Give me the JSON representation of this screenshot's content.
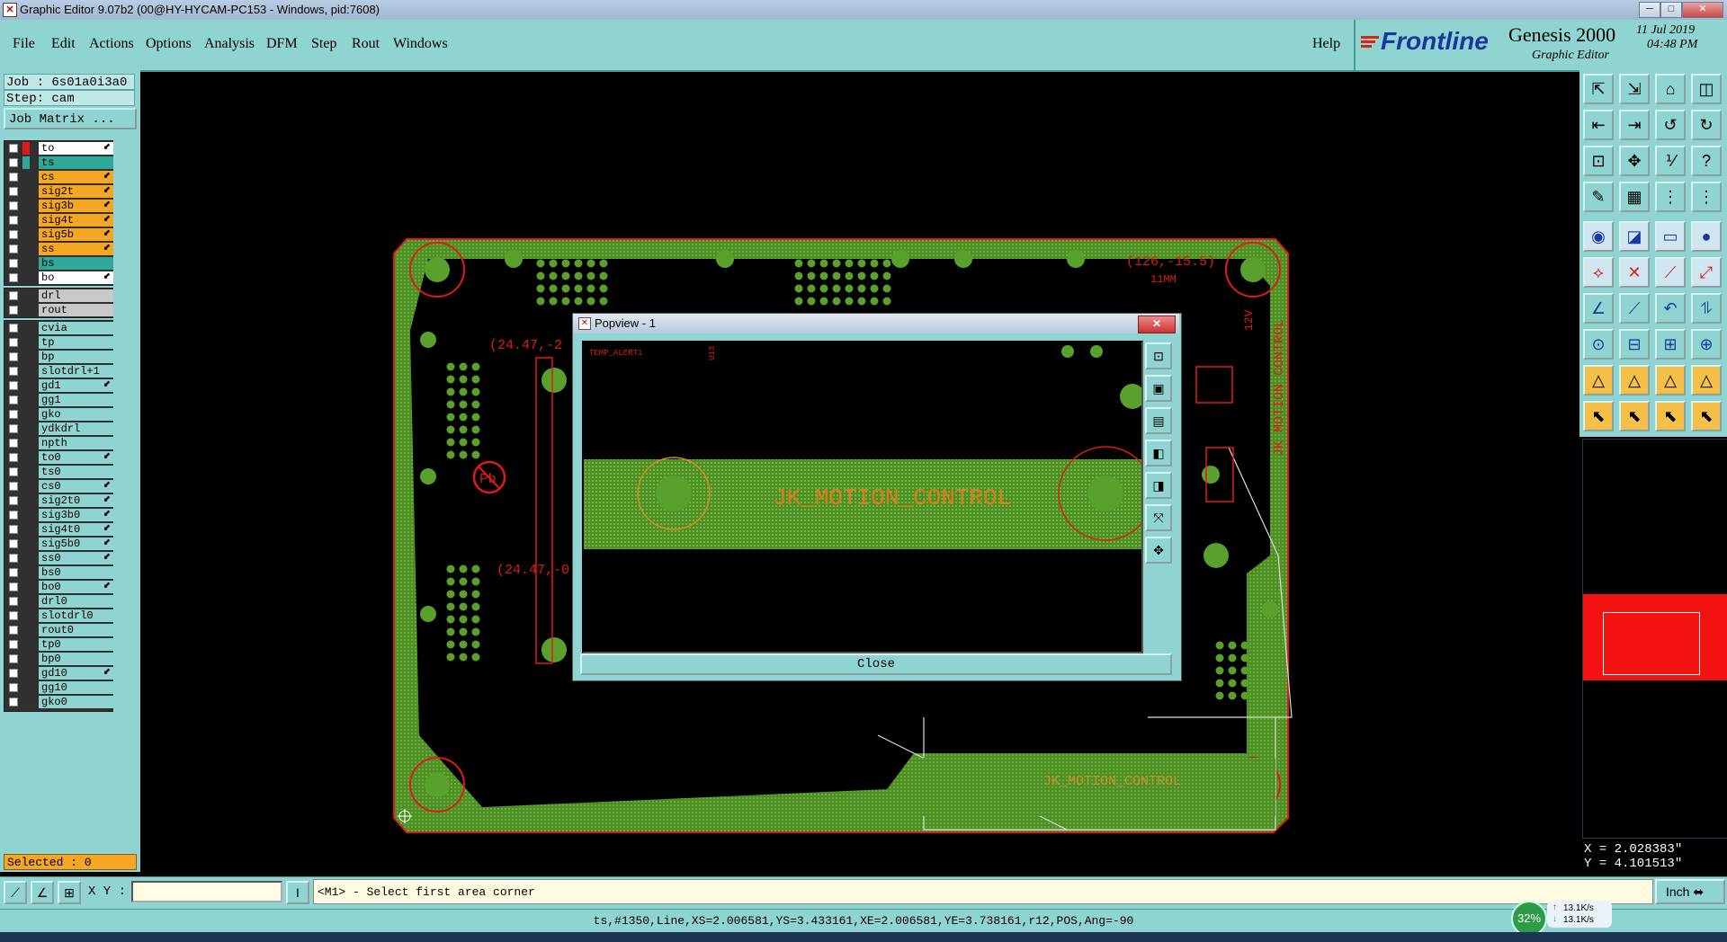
{
  "window": {
    "title": "Graphic Editor 9.07b2 (00@HY-HYCAM-PC153 - Windows, pid:7608)",
    "controls": [
      "─",
      "□",
      "✕"
    ]
  },
  "menu": {
    "items": [
      "File",
      "Edit",
      "Actions",
      "Options",
      "Analysis",
      "DFM",
      "Step",
      "Rout",
      "Windows"
    ],
    "help": "Help"
  },
  "logo": {
    "brand": "Frontline",
    "product": "Genesis 2000",
    "subtitle": "Graphic Editor",
    "date": "11 Jul 2019",
    "time": "04:48 PM"
  },
  "job": {
    "job_label": "Job : 6s01a0i3a0",
    "step_label": "Step: cam",
    "matrix_button": "Job Matrix ..."
  },
  "layers_group1": [
    {
      "name": "to",
      "color": "#ffffff",
      "mark": "⬋"
    },
    {
      "name": "ts",
      "color": "#2fa89a",
      "mark": ""
    },
    {
      "name": "cs",
      "color": "#f5a623",
      "mark": "⬋"
    },
    {
      "name": "sig2t",
      "color": "#f5a623",
      "mark": "⬋"
    },
    {
      "name": "sig3b",
      "color": "#f5a623",
      "mark": "⬋"
    },
    {
      "name": "sig4t",
      "color": "#f5a623",
      "mark": "⬋"
    },
    {
      "name": "sig5b",
      "color": "#f5a623",
      "mark": "⬋"
    },
    {
      "name": "ss",
      "color": "#f5a623",
      "mark": "⬋"
    },
    {
      "name": "bs",
      "color": "#2fa89a",
      "mark": ""
    },
    {
      "name": "bo",
      "color": "#ffffff",
      "mark": "⬋"
    }
  ],
  "layers_group2": [
    {
      "name": "drl",
      "color": "#c8c8c8",
      "mark": ""
    },
    {
      "name": "rout",
      "color": "#c8c8c8",
      "mark": ""
    }
  ],
  "layers_group3": [
    {
      "name": "cvia",
      "color": "#8fd4d0",
      "mark": ""
    },
    {
      "name": "tp",
      "color": "#8fd4d0",
      "mark": ""
    },
    {
      "name": "bp",
      "color": "#8fd4d0",
      "mark": ""
    },
    {
      "name": "slotdrl+1",
      "color": "#8fd4d0",
      "mark": ""
    },
    {
      "name": "gd1",
      "color": "#8fd4d0",
      "mark": "⬋"
    },
    {
      "name": "gg1",
      "color": "#8fd4d0",
      "mark": ""
    },
    {
      "name": "gko",
      "color": "#8fd4d0",
      "mark": ""
    },
    {
      "name": "ydkdrl",
      "color": "#8fd4d0",
      "mark": ""
    },
    {
      "name": "npth",
      "color": "#8fd4d0",
      "mark": ""
    },
    {
      "name": "to0",
      "color": "#8fd4d0",
      "mark": "⬋"
    },
    {
      "name": "ts0",
      "color": "#8fd4d0",
      "mark": ""
    },
    {
      "name": "cs0",
      "color": "#8fd4d0",
      "mark": "⬋"
    },
    {
      "name": "sig2t0",
      "color": "#8fd4d0",
      "mark": "⬋"
    },
    {
      "name": "sig3b0",
      "color": "#8fd4d0",
      "mark": "⬋"
    },
    {
      "name": "sig4t0",
      "color": "#8fd4d0",
      "mark": "⬋"
    },
    {
      "name": "sig5b0",
      "color": "#8fd4d0",
      "mark": "⬋"
    },
    {
      "name": "ss0",
      "color": "#8fd4d0",
      "mark": "⬋"
    },
    {
      "name": "bs0",
      "color": "#8fd4d0",
      "mark": ""
    },
    {
      "name": "bo0",
      "color": "#8fd4d0",
      "mark": "⬋"
    },
    {
      "name": "drl0",
      "color": "#8fd4d0",
      "mark": ""
    },
    {
      "name": "slotdrl0",
      "color": "#8fd4d0",
      "mark": ""
    },
    {
      "name": "rout0",
      "color": "#8fd4d0",
      "mark": ""
    },
    {
      "name": "tp0",
      "color": "#8fd4d0",
      "mark": ""
    },
    {
      "name": "bp0",
      "color": "#8fd4d0",
      "mark": ""
    },
    {
      "name": "gd10",
      "color": "#8fd4d0",
      "mark": "⬋"
    },
    {
      "name": "gg10",
      "color": "#8fd4d0",
      "mark": ""
    },
    {
      "name": "gko0",
      "color": "#8fd4d0",
      "mark": ""
    }
  ],
  "selected": "Selected : 0",
  "board": {
    "label_top_right": "(126,-15.5)",
    "label_11mm": "11MM",
    "label_left_top": "(24.47,-2",
    "label_left_bottom": "(24.47,-0",
    "vertical_text": "JK MOTION CONTROL",
    "label_12v": "12V",
    "bottom_text": "JK_MOTION_CONTROL",
    "pb_mark": "Pb"
  },
  "popview": {
    "title": "Popview - 1",
    "close_x": "✕",
    "canvas_text": "JK_MOTION_CONTROL",
    "canvas_label1": "TEMP_ALERT1",
    "canvas_label2": "U13",
    "close_button": "Close"
  },
  "coords": {
    "x": "X = 2.028383\"",
    "y": "Y = 4.101513\""
  },
  "bottom": {
    "xy_label": "X Y :",
    "prompt": "<M1> - Select first area corner",
    "units": "Inch"
  },
  "status_line": "ts,#1350,Line,XS=2.006581,YS=3.433161,XE=2.006581,YE=3.738161,r12,POS,Ang=-90",
  "network": {
    "percent": "32%",
    "up": "13.1K/s",
    "down": "13.1K/s"
  },
  "colors": {
    "panel": "#8fd4d0",
    "board_green": "#5aa02c",
    "drawing_red": "#e01a1a",
    "highlight_orange": "#f5a623"
  }
}
